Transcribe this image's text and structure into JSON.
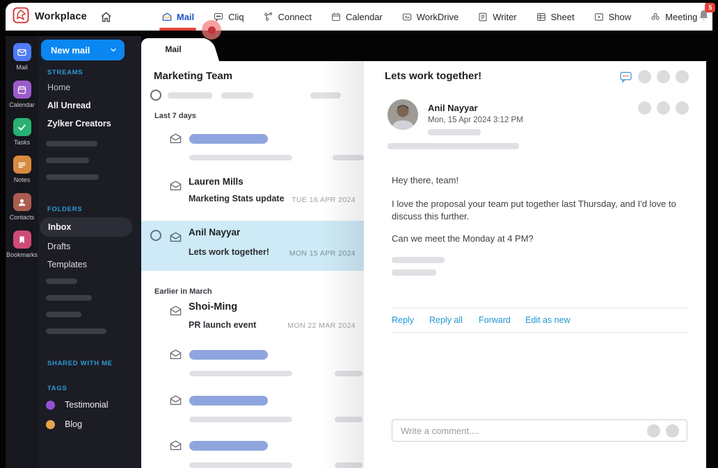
{
  "colors": {
    "accent-blue": "#0b87f2",
    "nav-active-blue": "#2253c4",
    "underline-red": "#e8413c",
    "link-blue": "#2196d3",
    "selected-row": "#cdeaf6",
    "sidebar-label-blue": "#2a9bd7",
    "skeleton-blue": "#8fa5de",
    "skeleton-gray": "#e0e0e5"
  },
  "chrome": {
    "brand": "Workplace",
    "notification_count": "5",
    "nav": [
      {
        "label": "Mail"
      },
      {
        "label": "Cliq"
      },
      {
        "label": "Connect"
      },
      {
        "label": "Calendar"
      },
      {
        "label": "WorkDrive"
      },
      {
        "label": "Writer"
      },
      {
        "label": "Sheet"
      },
      {
        "label": "Show"
      },
      {
        "label": "Meeting"
      }
    ]
  },
  "app_rail": {
    "items": [
      {
        "label": "Mail",
        "color": "#4f7cf7"
      },
      {
        "label": "Calendar",
        "color": "#9b5ccc"
      },
      {
        "label": "Tasks",
        "color": "#29b273"
      },
      {
        "label": "Notes",
        "color": "#d78b3f"
      },
      {
        "label": "Contacts",
        "color": "#ad5c50"
      },
      {
        "label": "Bookmarks",
        "color": "#ce4b78"
      }
    ]
  },
  "folder_pane": {
    "new_mail_label": "New mail",
    "streams_label": "STREAMS",
    "streams": [
      {
        "label": "Home"
      },
      {
        "label": "All Unread"
      },
      {
        "label": "Zylker Creators"
      }
    ],
    "folders_label": "FOLDERS",
    "folders": [
      {
        "label": "Inbox"
      },
      {
        "label": "Drafts"
      },
      {
        "label": "Templates"
      }
    ],
    "shared_label": "SHARED WITH ME",
    "tags_label": "TAGS",
    "tags": [
      {
        "label": "Testimonial",
        "color": "#9451d8"
      },
      {
        "label": "Blog",
        "color": "#e8a549"
      }
    ]
  },
  "list_pane": {
    "tab_label": "Mail",
    "title": "Marketing Team",
    "groups": [
      {
        "label": "Last 7 days",
        "items": [
          {
            "sender": "Lauren Mills",
            "subject": "Marketing Stats update",
            "date": "TUE 16 APR 2024"
          },
          {
            "sender": "Anil Nayyar",
            "subject": "Lets work together!",
            "date": "MON 15 APR 2024"
          }
        ]
      },
      {
        "label": "Earlier in March",
        "items": [
          {
            "sender": "Shoi-Ming",
            "subject": "PR launch event",
            "date": "MON 22 MAR 2024"
          }
        ]
      }
    ]
  },
  "reading_pane": {
    "subject": "Lets work together!",
    "sender": "Anil Nayyar",
    "timestamp": "Mon,  15 Apr 2024  3:12 PM",
    "body": [
      "Hey there, team!",
      "I love the proposal your team put together last Thursday, and I'd love to discuss this further.",
      "Can we meet the Monday at 4 PM?"
    ],
    "actions": [
      {
        "label": "Reply"
      },
      {
        "label": "Reply all"
      },
      {
        "label": "Forward"
      },
      {
        "label": "Edit as new"
      }
    ],
    "comment_placeholder": "Write a comment...."
  }
}
